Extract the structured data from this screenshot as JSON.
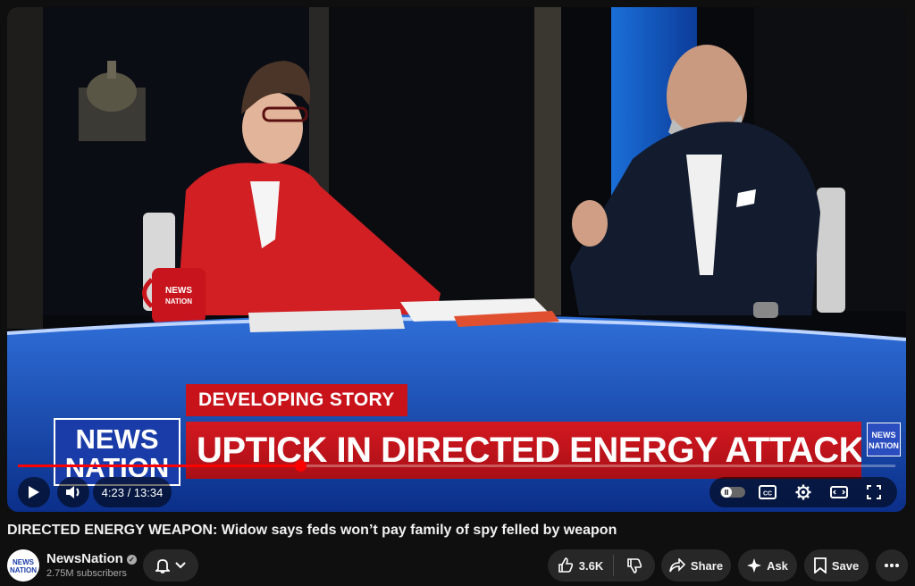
{
  "video": {
    "lower_third": {
      "tag": "DEVELOPING STORY",
      "headline": "UPTICK IN DIRECTED ENERGY ATTACKS IN U.S.",
      "logo_line1": "NEWS",
      "logo_line2": "NATION",
      "corner_logo_line1": "NEWS",
      "corner_logo_line2": "NATION"
    },
    "mug_logo": "NEWS NATION",
    "progress_fraction": 0.3215,
    "time_display": "4:23 / 13:34",
    "colors": {
      "progress": "#ff0000",
      "banner_red": "#c8131b",
      "logo_blue": "#1a3ca8"
    },
    "controls": {
      "play_icon": "play-icon",
      "volume_icon": "volume-icon",
      "pause_toggle_icon": "autoplay-toggle-icon",
      "cc_icon": "closed-captions-icon",
      "settings_icon": "gear-icon",
      "theater_icon": "theater-mode-icon",
      "fullscreen_icon": "fullscreen-icon",
      "cc_label": "CC"
    }
  },
  "title": "DIRECTED ENERGY WEAPON: Widow says feds won’t pay family of spy felled by weapon",
  "channel": {
    "avatar_line1": "NEWS",
    "avatar_line2": "NATION",
    "name": "NewsNation",
    "subscribers": "2.75M subscribers"
  },
  "actions": {
    "likes": "3.6K",
    "share": "Share",
    "ask": "Ask",
    "save": "Save"
  }
}
